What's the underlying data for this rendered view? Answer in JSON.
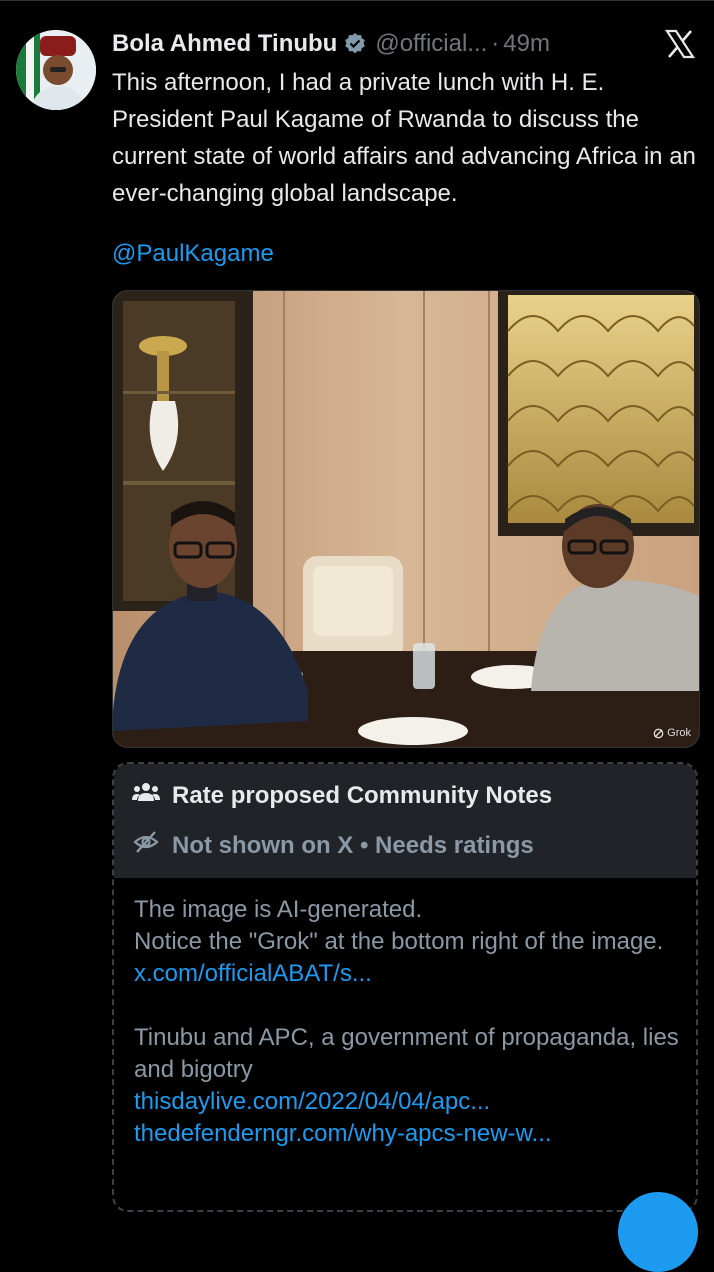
{
  "tweet": {
    "author_name": "Bola Ahmed Tinubu",
    "handle": "@official...",
    "separator": "·",
    "time": "49m",
    "text": "This afternoon, I had a private lunch with H. E. President Paul Kagame of Rwanda to discuss the current state of world affairs and advancing Africa in an ever-changing global landscape.",
    "mention": "@PaulKagame",
    "media_watermark": "Grok"
  },
  "community_note": {
    "header": "Rate proposed Community Notes",
    "status": "Not shown on X • Needs ratings",
    "line1": "The image is AI-generated.",
    "line2": "Notice the \"Grok\" at the bottom right of the image.",
    "link1": "x.com/officialABAT/s...",
    "line3": "Tinubu and APC, a government of propaganda, lies and bigotry",
    "link2": "thisdaylive.com/2022/04/04/apc...",
    "link3": "thedefenderngr.com/why-apcs-new-w..."
  },
  "icons": {
    "verified": "verified-badge-icon",
    "x_logo": "x-logo-icon",
    "people": "people-icon",
    "not_shown": "eye-slash-icon"
  },
  "colors": {
    "background": "#000000",
    "text": "#e7e9ea",
    "secondary": "#71767b",
    "link": "#1d9bf0",
    "note_header": "#202327"
  }
}
